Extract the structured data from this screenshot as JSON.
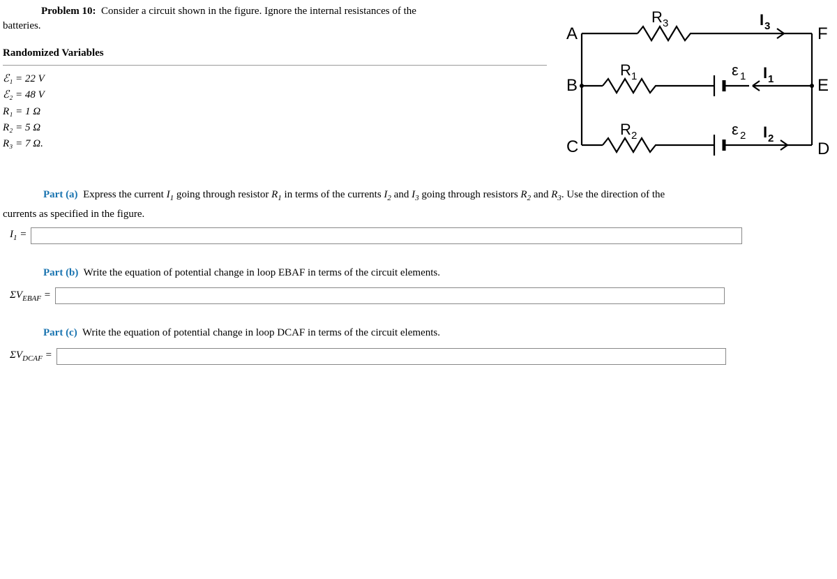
{
  "problem": {
    "number_label": "Problem 10:",
    "statement_1": "Consider a circuit shown in the figure. Ignore the internal resistances of the",
    "statement_2": "batteries.",
    "rand_vars_heading": "Randomized Variables",
    "vars": {
      "e1": "ℰ₁ = 22 V",
      "e2": "ℰ₂ = 48 V",
      "r1": "R₁ = 1 Ω",
      "r2": "R₂ = 5 Ω",
      "r3": "R₃ = 7 Ω."
    }
  },
  "parts": {
    "a": {
      "label": "Part (a)",
      "text": "Express the current I₁ going through resistor R₁ in terms of the currents I₂ and I₃ going through resistors R₂ and R₃. Use the direction of the currents as specified in the figure.",
      "answer_label": "I₁ ="
    },
    "b": {
      "label": "Part (b)",
      "text": "Write the equation of potential change in loop EBAF in terms of the circuit elements.",
      "answer_label": "ΣV_EBAF ="
    },
    "c": {
      "label": "Part (c)",
      "text": "Write the equation of potential change in loop DCAF in terms of the circuit elements.",
      "answer_label": "ΣV_DCAF ="
    }
  },
  "figure": {
    "nodes": {
      "A": "A",
      "B": "B",
      "C": "C",
      "D": "D",
      "E": "E",
      "F": "F"
    },
    "components": {
      "R1": "R₁",
      "R2": "R₂",
      "R3": "R₃",
      "e1": "ε₁",
      "e2": "ε₂",
      "I1": "I₁",
      "I2": "I₂",
      "I3": "I₃"
    }
  }
}
